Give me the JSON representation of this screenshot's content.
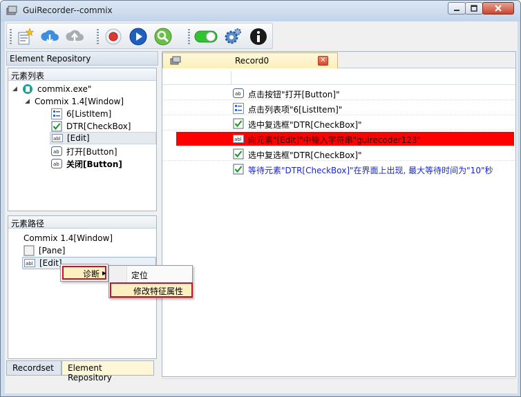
{
  "window": {
    "title": "GuiRecorder--commix"
  },
  "left_panel": {
    "title": "Element Repository",
    "element_list_label": "元素列表",
    "tree": [
      {
        "label": "commix.exe\"",
        "bold": false
      },
      {
        "label": "Commix 1.4[Window]",
        "bold": false
      },
      {
        "label": "6[ListItem]",
        "bold": false
      },
      {
        "label": "DTR[CheckBox]",
        "bold": false
      },
      {
        "label": "[Edit]",
        "bold": false
      },
      {
        "label": "打开[Button]",
        "bold": false
      },
      {
        "label": "关闭[Button]",
        "bold": true
      }
    ],
    "element_path_label": "元素路径",
    "path": [
      {
        "label": "Commix 1.4[Window]"
      },
      {
        "label": "[Pane]"
      },
      {
        "label": "[Edit]"
      }
    ],
    "bottom_tabs": [
      "Recordset",
      "Element Repository"
    ]
  },
  "context_menu": {
    "diagnose": "诊断",
    "submenu": [
      "定位",
      "修改特征属性"
    ]
  },
  "document": {
    "tab_title": "Record0",
    "steps": [
      {
        "text": "点击按钮\"打开[Button]\"",
        "icon": "button-ab-icon"
      },
      {
        "text": "点击列表项\"6[ListItem]\"",
        "icon": "listitem-icon"
      },
      {
        "text": "选中复选框\"DTR[CheckBox]\"",
        "icon": "checkbox-icon"
      },
      {
        "text": "向元素\"[Edit]\"中输入字符串\"guirecoder123\"",
        "icon": "edit-abl-icon"
      },
      {
        "text": "选中复选框\"DTR[CheckBox]\"",
        "icon": "checkbox-icon"
      },
      {
        "text": "等待元素\"DTR[CheckBox]\"在界面上出现, 最大等待时间为\"10\"秒",
        "icon": "checkbox-icon"
      }
    ]
  },
  "colors": {
    "highlight_row": "#ff0000",
    "menu_highlight_border": "#c8102e",
    "wait_step_text": "#1a26c8"
  }
}
